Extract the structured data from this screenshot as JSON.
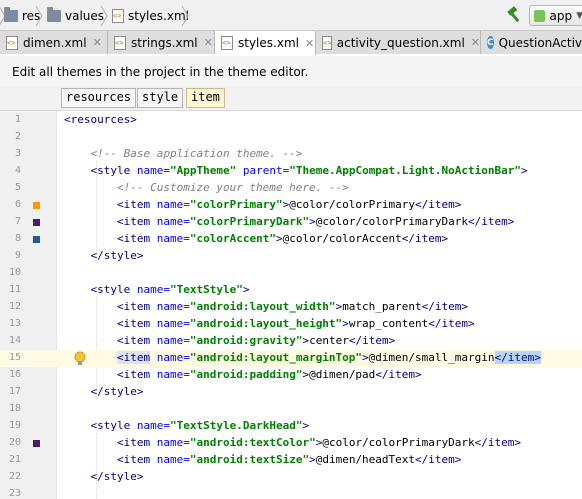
{
  "breadcrumb": {
    "items": [
      {
        "label": "res",
        "icon": "folder-icon"
      },
      {
        "label": "values",
        "icon": "folder-icon"
      },
      {
        "label": "styles.xml",
        "icon": "xml-file-icon"
      }
    ]
  },
  "toolbar": {
    "run_config_label": "app"
  },
  "tabs": [
    {
      "label": "dimen.xml",
      "icon": "xml-file-icon",
      "active": false
    },
    {
      "label": "strings.xml",
      "icon": "xml-file-icon",
      "active": false
    },
    {
      "label": "styles.xml",
      "icon": "xml-file-icon",
      "active": true
    },
    {
      "label": "activity_question.xml",
      "icon": "xml-file-icon",
      "active": false
    },
    {
      "label": "QuestionActivi",
      "icon": "class-icon",
      "active": false
    }
  ],
  "banner": {
    "text": "Edit all themes in the project in the theme editor."
  },
  "tag_breadcrumb": [
    "resources",
    "style",
    "item"
  ],
  "editor": {
    "caret_line": 15,
    "lines": [
      {
        "n": "1",
        "swatch": null
      },
      {
        "n": "2",
        "swatch": null
      },
      {
        "n": "3",
        "swatch": null
      },
      {
        "n": "4",
        "swatch": null
      },
      {
        "n": "5",
        "swatch": null
      },
      {
        "n": "6",
        "swatch": "#ff9800"
      },
      {
        "n": "7",
        "swatch": "#4a1d6b"
      },
      {
        "n": "8",
        "swatch": "#1e5b9c"
      },
      {
        "n": "9",
        "swatch": null
      },
      {
        "n": "10",
        "swatch": null
      },
      {
        "n": "11",
        "swatch": null
      },
      {
        "n": "12",
        "swatch": null
      },
      {
        "n": "13",
        "swatch": null
      },
      {
        "n": "14",
        "swatch": null
      },
      {
        "n": "15",
        "swatch": null
      },
      {
        "n": "16",
        "swatch": null
      },
      {
        "n": "17",
        "swatch": null
      },
      {
        "n": "18",
        "swatch": null
      },
      {
        "n": "19",
        "swatch": null
      },
      {
        "n": "20",
        "swatch": "#4a1d6b"
      },
      {
        "n": "21",
        "swatch": null
      },
      {
        "n": "22",
        "swatch": null
      },
      {
        "n": "23",
        "swatch": null
      }
    ],
    "text": {
      "l1": "<resources>",
      "l3": "<!-- Base application theme. -->",
      "l4_tag": "<style",
      "l4_attr": "name=",
      "l4_val": "\"AppTheme\"",
      "l4_attr2": "parent=",
      "l4_val2": "\"Theme.AppCompat.Light.NoActionBar\"",
      "l4_end": ">",
      "l5": "<!-- Customize your theme here. -->",
      "l6_val": "\"colorPrimary\"",
      "l6_text": "@color/colorPrimary",
      "l7_val": "\"colorPrimaryDark\"",
      "l7_text": "@color/colorPrimaryDark",
      "l8_val": "\"colorAccent\"",
      "l8_text": "@color/colorAccent",
      "l9": "</style>",
      "l11_val": "\"TextStyle\"",
      "l12_val": "\"android:layout_width\"",
      "l12_text": "match_parent",
      "l13_val": "\"android:layout_height\"",
      "l13_text": "wrap_content",
      "l14_val": "\"android:gravity\"",
      "l14_text": "center",
      "l15_val": "\"android:layout_marginTop\"",
      "l15_text": "@dimen/small_margin",
      "l16_val": "\"android:padding\"",
      "l16_text": "@dimen/pad",
      "l17": "</style>",
      "l19_val": "\"TextStyle.DarkHead\"",
      "l20_val": "\"android:textColor\"",
      "l20_text": "@color/colorPrimaryDark",
      "l21_val": "\"android:textSize\"",
      "l21_text": "@dimen/headText",
      "l22": "</style>",
      "item_open": "<item",
      "item_close": "</item>",
      "style_open": "<style",
      "name_attr": "name=",
      "gt": ">"
    }
  }
}
